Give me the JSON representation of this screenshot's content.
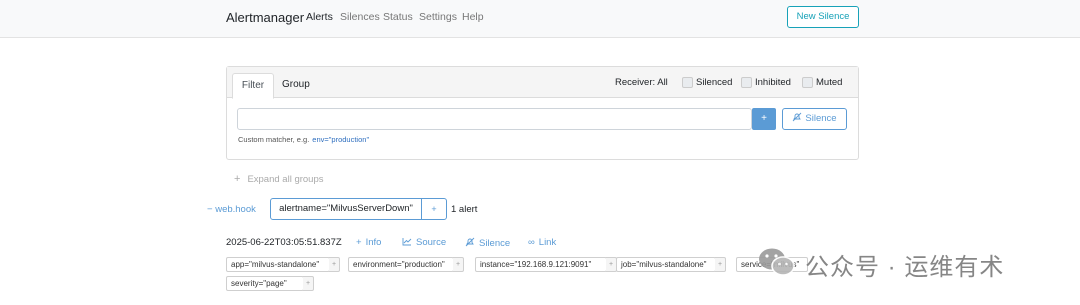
{
  "nav": {
    "brand": "Alertmanager",
    "links": [
      {
        "label": "Alerts"
      },
      {
        "label": "Silences"
      },
      {
        "label": "Status"
      },
      {
        "label": "Settings"
      },
      {
        "label": "Help"
      }
    ],
    "new_silence_label": "New Silence"
  },
  "filter": {
    "tabs": [
      "Filter",
      "Group"
    ],
    "receiver": "Receiver: All",
    "checkboxes": [
      {
        "label": "Silenced",
        "checked": false
      },
      {
        "label": "Inhibited",
        "checked": false
      },
      {
        "label": "Muted",
        "checked": false
      }
    ],
    "input_value": "",
    "plus_label": "+",
    "silence_label": "Silence",
    "hint": "Custom matcher, e.g.",
    "hint_example": "env=\"production\""
  },
  "expand_label": "Expand all groups",
  "group": {
    "receiver": "web.hook",
    "matcher": "alertname=\"MilvusServerDown\"",
    "add_label": "+",
    "alert_count": "1 alert"
  },
  "alert": {
    "timestamp": "2025-06-22T03:05:51.837Z",
    "actions": [
      "Info",
      "Source",
      "Silence",
      "Link"
    ],
    "labels": [
      "app=\"milvus-standalone\"",
      "environment=\"production\"",
      "instance=\"192.168.9.121:9091\"",
      "job=\"milvus-standalone\"",
      "service=\"milvus\"",
      "severity=\"page\""
    ],
    "label_add": "+"
  },
  "watermark": "公众号 · 运维有术",
  "colors": {
    "accent": "#5b9bd5",
    "info": "#17a2b8",
    "navbar": "#f8f9fa"
  }
}
